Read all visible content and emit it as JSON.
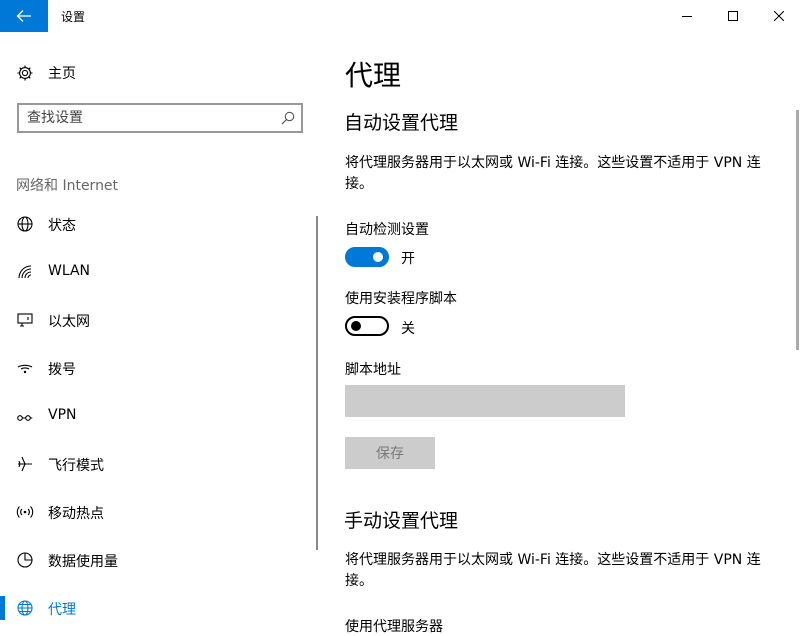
{
  "window": {
    "title": "设置"
  },
  "nav": {
    "home_label": "主页",
    "search_placeholder": "查找设置",
    "section_label": "网络和 Internet",
    "items": [
      {
        "label": "状态",
        "icon": "globe-status-icon"
      },
      {
        "label": "WLAN",
        "icon": "wifi-icon"
      },
      {
        "label": "以太网",
        "icon": "ethernet-icon"
      },
      {
        "label": "拨号",
        "icon": "dialup-icon"
      },
      {
        "label": "VPN",
        "icon": "vpn-icon"
      },
      {
        "label": "飞行模式",
        "icon": "airplane-icon"
      },
      {
        "label": "移动热点",
        "icon": "hotspot-icon"
      },
      {
        "label": "数据使用量",
        "icon": "data-usage-icon"
      },
      {
        "label": "代理",
        "icon": "globe-icon",
        "active": true
      }
    ]
  },
  "content": {
    "page_title": "代理",
    "auto_section": {
      "heading": "自动设置代理",
      "description": "将代理服务器用于以太网或 Wi-Fi 连接。这些设置不适用于 VPN 连接。",
      "auto_detect_label": "自动检测设置",
      "auto_detect_state": "开",
      "auto_detect_on": true,
      "script_label": "使用安装程序脚本",
      "script_state": "关",
      "script_on": false,
      "script_address_label": "脚本地址",
      "script_address_value": "",
      "save_label": "保存"
    },
    "manual_section": {
      "heading": "手动设置代理",
      "description": "将代理服务器用于以太网或 Wi-Fi 连接。这些设置不适用于 VPN 连接。",
      "use_proxy_label": "使用代理服务器"
    }
  },
  "colors": {
    "accent": "#0078d7",
    "disabled_bg": "#cccccc",
    "disabled_text": "#7a7a7a"
  }
}
